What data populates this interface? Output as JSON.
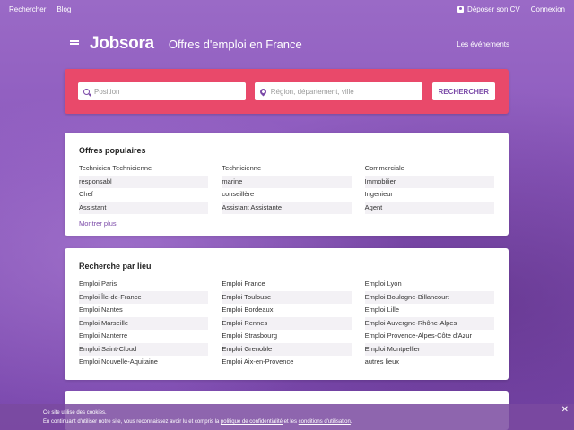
{
  "topbar": {
    "search": "Rechercher",
    "blog": "Blog",
    "post_cv": "Déposer son CV",
    "login": "Connexion"
  },
  "header": {
    "logo": "Jobsora",
    "tagline": "Offres d'emploi en France",
    "events": "Les événements"
  },
  "search": {
    "position_placeholder": "Position",
    "location_placeholder": "Région, département, ville",
    "button": "RECHERCHER"
  },
  "popular": {
    "title": "Offres populaires",
    "items": [
      "Technicien Technicienne",
      "Technicienne",
      "Commerciale",
      "responsabl",
      "marine",
      "Immobilier",
      "Chef",
      "conseillère",
      "Ingenieur",
      "Assistant",
      "Assistant Assistante",
      "Agent"
    ],
    "more": "Montrer plus"
  },
  "location": {
    "title": "Recherche par lieu",
    "items": [
      "Emploi Paris",
      "Emploi France",
      "Emploi Lyon",
      "Emploi Île-de-France",
      "Emploi Toulouse",
      "Emploi Boulogne-Billancourt",
      "Emploi Nantes",
      "Emploi Bordeaux",
      "Emploi Lille",
      "Emploi Marseille",
      "Emploi Rennes",
      "Emploi Auvergne-Rhône-Alpes",
      "Emploi Nanterre",
      "Emploi Strasbourg",
      "Emploi Provence-Alpes-Côte d'Azur",
      "Emploi Saint-Cloud",
      "Emploi Grenoble",
      "Emploi Montpellier",
      "Emploi Nouvelle-Aquitaine",
      "Emploi Aix-en-Provence",
      "autres lieux"
    ]
  },
  "cookie": {
    "line1": "Ce site utilise des cookies.",
    "line2_prefix": "En continuant d'utiliser notre site, vous reconnaissez avoir lu et compris la ",
    "privacy_link": "politique de confidentialité",
    "line2_middle": " et les ",
    "terms_link": "conditions d'utilisation",
    "line2_suffix": ".",
    "close": "✕"
  },
  "colors": {
    "brand_purple": "#7b4aa8",
    "search_panel": "#e9496a"
  }
}
